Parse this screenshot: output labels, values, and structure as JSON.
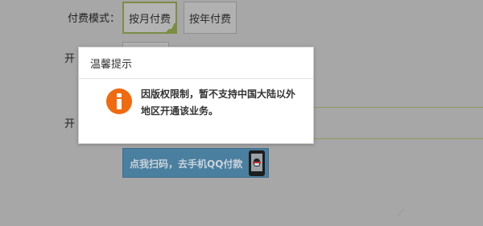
{
  "form": {
    "billing_mode_label": "付费模式：",
    "open_label_1": "开",
    "open_label_2": "开",
    "plans": [
      {
        "label": "按月付费",
        "selected": true
      },
      {
        "label": "按年付费",
        "selected": false
      }
    ],
    "scan_pay_button_label": "点我扫码，去手机QQ付款"
  },
  "modal": {
    "title": "温馨提示",
    "message": "因版权限制，暂不支持中国大陆以外地区开通该业务。",
    "icon": "info-icon"
  },
  "colors": {
    "overlay": "#a7a7a7",
    "selected_border": "#7c8d43",
    "info_icon": "#f06a0f",
    "pay_button": "#4a7fa0"
  }
}
